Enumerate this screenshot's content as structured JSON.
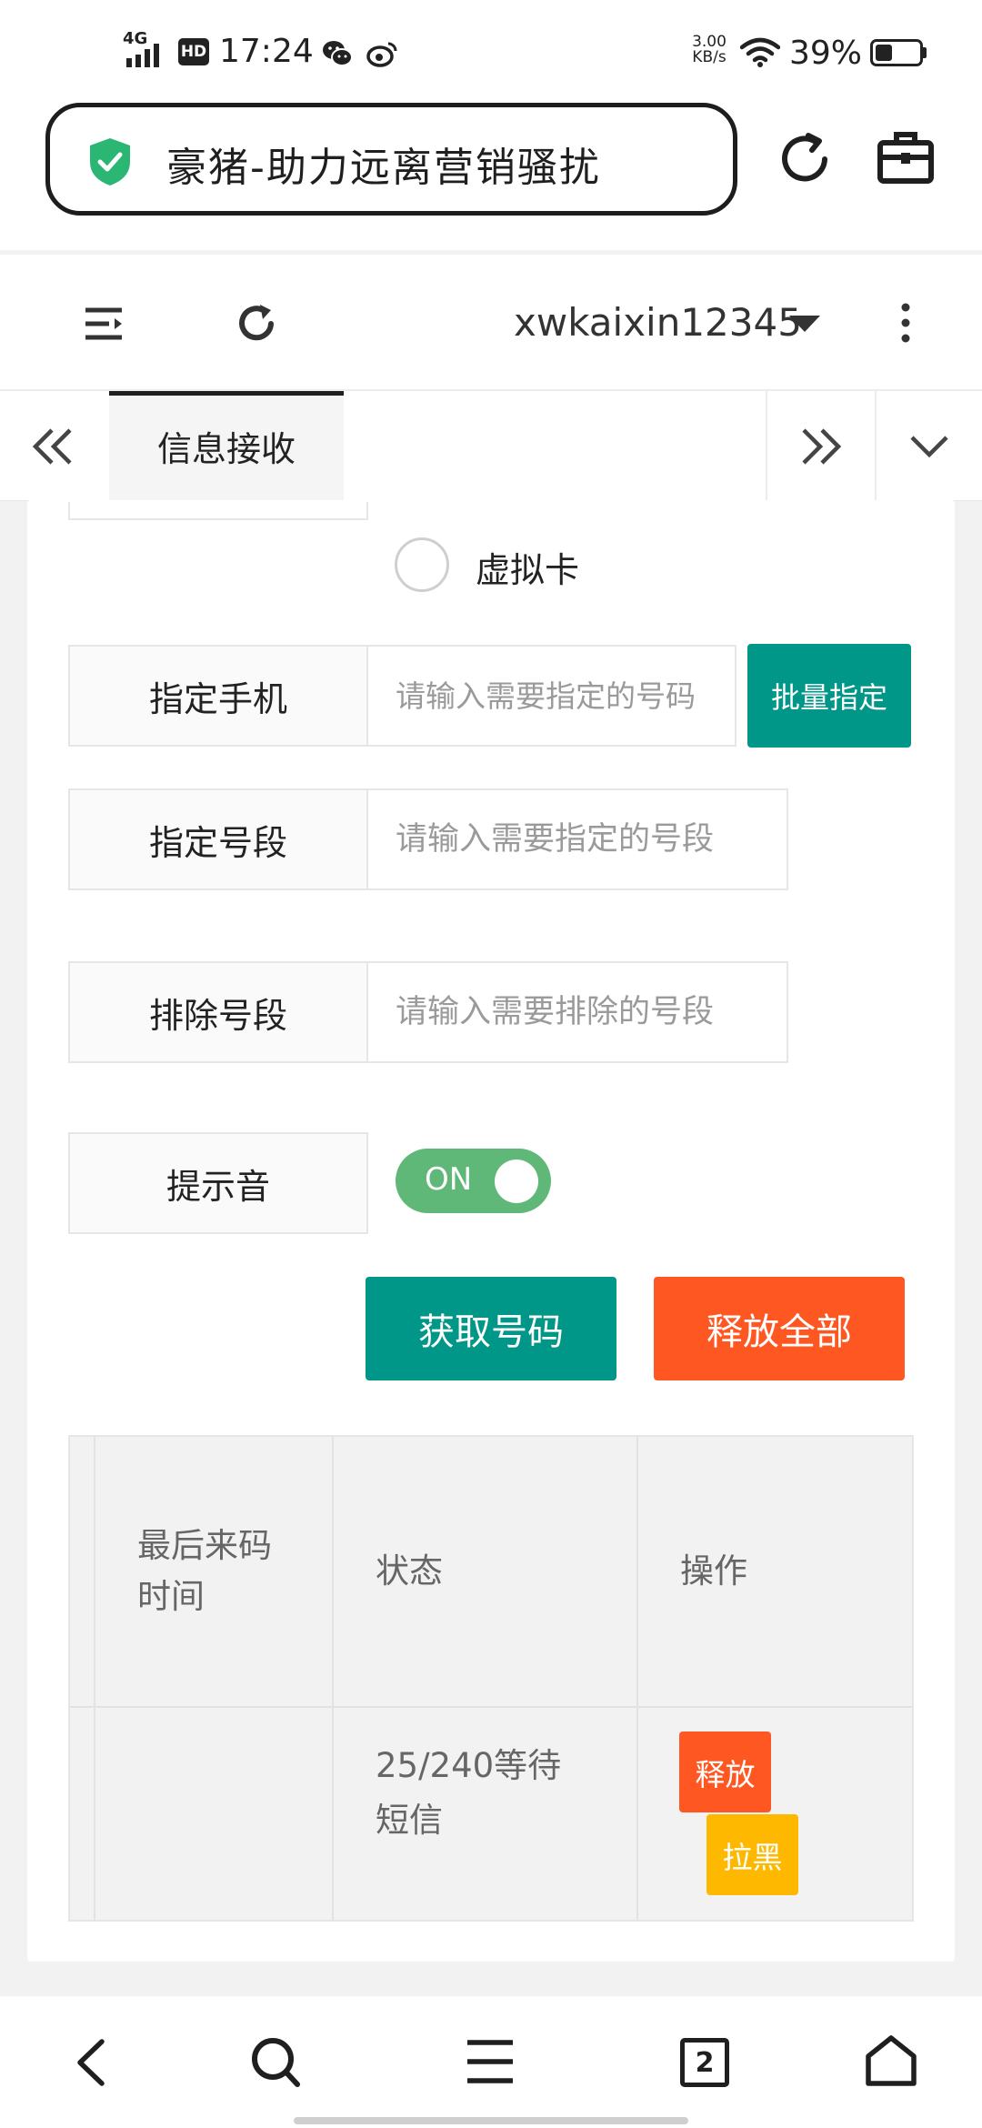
{
  "status_bar": {
    "network": "4G",
    "hd": "HD",
    "time": "17:24",
    "speed_value": "3.00",
    "speed_unit": "KB/s",
    "battery": "39%",
    "battery_level": 0.39
  },
  "browser": {
    "title": "豪猪-助力远离营销骚扰",
    "secure_color": "#2bb673"
  },
  "header": {
    "username": "xwkaixin12345"
  },
  "tabs": [
    {
      "label": "信息接收",
      "active": true
    }
  ],
  "form": {
    "virtual_card_label": "虚拟卡",
    "phone": {
      "label": "指定手机",
      "placeholder": "请输入需要指定的号码",
      "button": "批量指定"
    },
    "prefix": {
      "label": "指定号段",
      "placeholder": "请输入需要指定的号段"
    },
    "exclude": {
      "label": "排除号段",
      "placeholder": "请输入需要排除的号段"
    },
    "sound": {
      "label": "提示音",
      "toggle": "ON"
    },
    "get_number_button": "获取号码",
    "release_all_button": "释放全部"
  },
  "table": {
    "headers": {
      "last_time_line1": "最后来码",
      "last_time_line2": "时间",
      "status": "状态",
      "action": "操作"
    },
    "rows": [
      {
        "last_time": "",
        "status_line1": "25/240等待",
        "status_line2": "短信",
        "release": "释放",
        "blacklist": "拉黑"
      }
    ]
  },
  "bottom_nav": {
    "tab_count": "2"
  },
  "colors": {
    "teal": "#009688",
    "orange": "#ff5722",
    "yellow": "#ffb800",
    "toggle_on": "#5fb878"
  }
}
